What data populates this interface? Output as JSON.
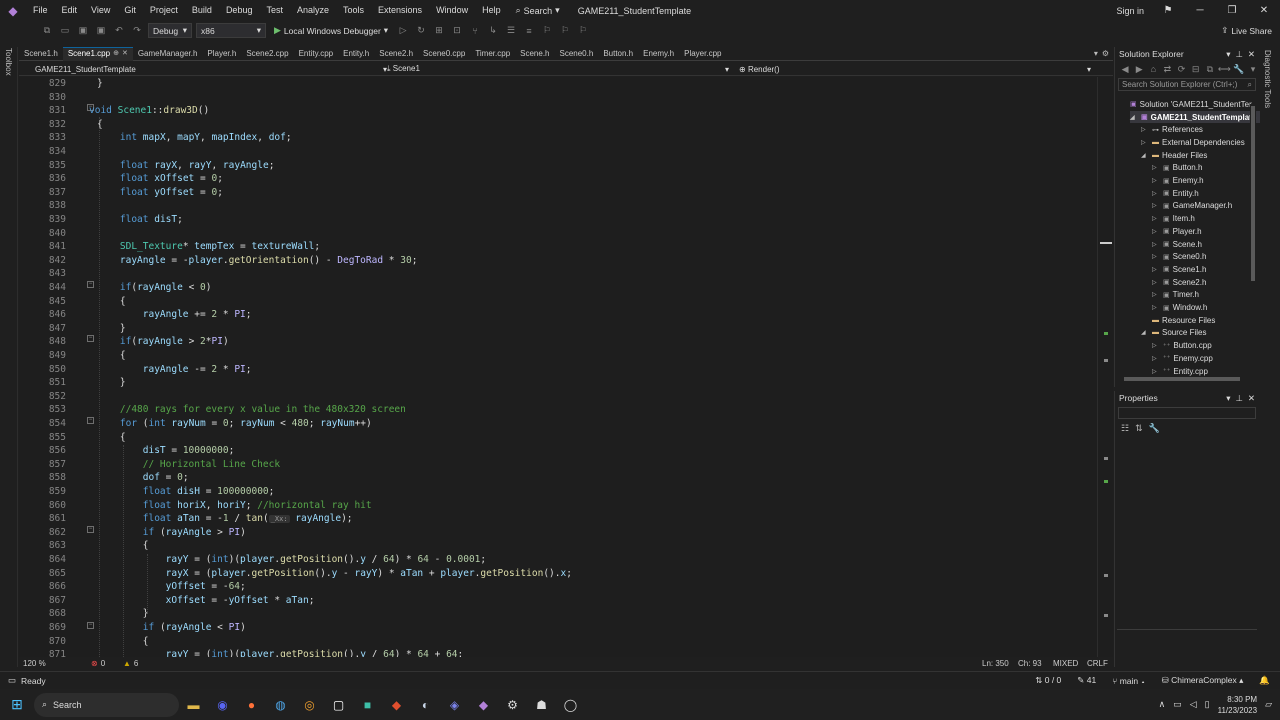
{
  "menu": [
    "File",
    "Edit",
    "View",
    "Git",
    "Project",
    "Build",
    "Debug",
    "Test",
    "Analyze",
    "Tools",
    "Extensions",
    "Window",
    "Help"
  ],
  "search_menu": "Search",
  "solution_title": "GAME211_StudentTemplate",
  "signin": "Sign in",
  "toolbar": {
    "config": "Debug",
    "platform": "x86",
    "run_label": "Local Windows Debugger",
    "live_share": "Live Share"
  },
  "toolbox_label": "Toolbox",
  "diagnostics_label": "Diagnostic Tools",
  "tabs": [
    {
      "label": "Scene1.h",
      "active": false
    },
    {
      "label": "Scene1.cpp",
      "active": true
    },
    {
      "label": "GameManager.h",
      "active": false
    },
    {
      "label": "Player.h",
      "active": false
    },
    {
      "label": "Scene2.cpp",
      "active": false
    },
    {
      "label": "Entity.cpp",
      "active": false
    },
    {
      "label": "Entity.h",
      "active": false
    },
    {
      "label": "Scene2.h",
      "active": false
    },
    {
      "label": "Scene0.cpp",
      "active": false
    },
    {
      "label": "Timer.cpp",
      "active": false
    },
    {
      "label": "Scene.h",
      "active": false
    },
    {
      "label": "Scene0.h",
      "active": false
    },
    {
      "label": "Button.h",
      "active": false
    },
    {
      "label": "Enemy.h",
      "active": false
    },
    {
      "label": "Player.cpp",
      "active": false
    }
  ],
  "nav": {
    "project": "GAME211_StudentTemplate",
    "class": "Scene1",
    "member": "Render()"
  },
  "line_numbers": [
    "829",
    "830",
    "831",
    "832",
    "833",
    "834",
    "835",
    "836",
    "837",
    "838",
    "839",
    "840",
    "841",
    "842",
    "843",
    "844",
    "845",
    "846",
    "847",
    "848",
    "849",
    "850",
    "851",
    "852",
    "853",
    "854",
    "855",
    "856",
    "857",
    "858",
    "859",
    "860",
    "861",
    "862",
    "863",
    "864",
    "865",
    "866",
    "867",
    "868",
    "869",
    "870",
    "871"
  ],
  "status_editor": {
    "zoom": "120 %",
    "errors": "0",
    "warnings": "6",
    "line": "Ln: 350",
    "ch": "Ch: 93",
    "mixed": "MIXED",
    "crlf": "CRLF"
  },
  "solution_explorer": {
    "title": "Solution Explorer",
    "search_placeholder": "Search Solution Explorer (Ctrl+;)",
    "items": [
      {
        "label": "Solution 'GAME211_StudentTer",
        "indent": 0,
        "arrow": "",
        "icon": "solution"
      },
      {
        "label": "GAME211_StudentTemplate",
        "indent": 1,
        "arrow": "◢",
        "icon": "project",
        "selected": true
      },
      {
        "label": "References",
        "indent": 2,
        "arrow": "▷",
        "icon": "ref"
      },
      {
        "label": "External Dependencies",
        "indent": 2,
        "arrow": "▷",
        "icon": "folder"
      },
      {
        "label": "Header Files",
        "indent": 2,
        "arrow": "◢",
        "icon": "folder"
      },
      {
        "label": "Button.h",
        "indent": 3,
        "arrow": "▷",
        "icon": "h"
      },
      {
        "label": "Enemy.h",
        "indent": 3,
        "arrow": "▷",
        "icon": "h"
      },
      {
        "label": "Entity.h",
        "indent": 3,
        "arrow": "▷",
        "icon": "h"
      },
      {
        "label": "GameManager.h",
        "indent": 3,
        "arrow": "▷",
        "icon": "h"
      },
      {
        "label": "Item.h",
        "indent": 3,
        "arrow": "▷",
        "icon": "h"
      },
      {
        "label": "Player.h",
        "indent": 3,
        "arrow": "▷",
        "icon": "h"
      },
      {
        "label": "Scene.h",
        "indent": 3,
        "arrow": "▷",
        "icon": "h"
      },
      {
        "label": "Scene0.h",
        "indent": 3,
        "arrow": "▷",
        "icon": "h"
      },
      {
        "label": "Scene1.h",
        "indent": 3,
        "arrow": "▷",
        "icon": "h"
      },
      {
        "label": "Scene2.h",
        "indent": 3,
        "arrow": "▷",
        "icon": "h"
      },
      {
        "label": "Timer.h",
        "indent": 3,
        "arrow": "▷",
        "icon": "h"
      },
      {
        "label": "Window.h",
        "indent": 3,
        "arrow": "▷",
        "icon": "h"
      },
      {
        "label": "Resource Files",
        "indent": 2,
        "arrow": "",
        "icon": "folder"
      },
      {
        "label": "Source Files",
        "indent": 2,
        "arrow": "◢",
        "icon": "folder"
      },
      {
        "label": "Button.cpp",
        "indent": 3,
        "arrow": "▷",
        "icon": "cpp"
      },
      {
        "label": "Enemy.cpp",
        "indent": 3,
        "arrow": "▷",
        "icon": "cpp"
      },
      {
        "label": "Entity.cpp",
        "indent": 3,
        "arrow": "▷",
        "icon": "cpp"
      }
    ]
  },
  "properties": {
    "title": "Properties"
  },
  "statusbar": {
    "ready": "Ready",
    "changes": "0 / 0",
    "commits": "41",
    "branch": "main",
    "repo": "ChimeraComplex"
  },
  "taskbar": {
    "search": "Search",
    "time": "8:30 PM",
    "date": "11/23/2023"
  },
  "colors": {
    "keyword": "#569cd6",
    "type": "#4ec9b0",
    "function": "#dcdcaa",
    "number": "#b5cea8",
    "comment": "#57a64a",
    "variable": "#9cdcfe",
    "macro": "#beb7ff"
  }
}
